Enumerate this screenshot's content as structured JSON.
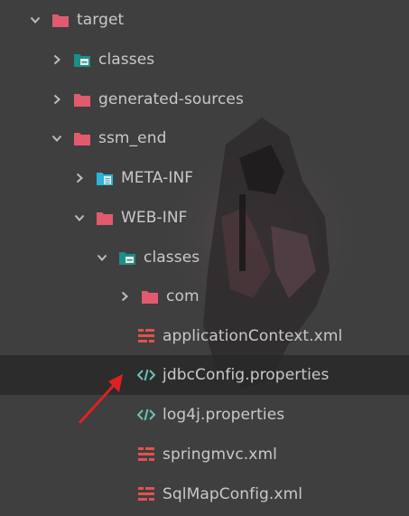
{
  "tree": [
    {
      "label": "target",
      "type": "folder",
      "icon": "folder-icon",
      "expanded": true
    },
    {
      "label": "classes",
      "type": "folder-output",
      "icon": "output-folder-icon",
      "expanded": false
    },
    {
      "label": "generated-sources",
      "type": "folder",
      "icon": "folder-icon",
      "expanded": false
    },
    {
      "label": "ssm_end",
      "type": "folder",
      "icon": "folder-icon",
      "expanded": true
    },
    {
      "label": "META-INF",
      "type": "folder-meta",
      "icon": "meta-folder-icon",
      "expanded": false
    },
    {
      "label": "WEB-INF",
      "type": "folder",
      "icon": "folder-icon",
      "expanded": true
    },
    {
      "label": "classes",
      "type": "folder-output",
      "icon": "output-folder-icon",
      "expanded": true
    },
    {
      "label": "com",
      "type": "folder",
      "icon": "folder-icon",
      "expanded": false
    },
    {
      "label": "applicationContext.xml",
      "type": "xml",
      "icon": "xml-file-icon"
    },
    {
      "label": "jdbcConfig.properties",
      "type": "properties",
      "icon": "properties-file-icon",
      "selected": true
    },
    {
      "label": "log4j.properties",
      "type": "properties",
      "icon": "properties-file-icon"
    },
    {
      "label": "springmvc.xml",
      "type": "xml",
      "icon": "xml-file-icon"
    },
    {
      "label": "SqlMapConfig.xml",
      "type": "xml",
      "icon": "xml-file-icon"
    }
  ],
  "colors": {
    "background": "#3f3f3f",
    "folder": "#e15a6e",
    "output_folder": "#1a8f88",
    "meta_folder": "#2ab4d8",
    "xml": "#e0534f",
    "properties": "#69c4b8",
    "annotation_arrow": "#e02020",
    "selected_row": "#2a2a2a"
  }
}
